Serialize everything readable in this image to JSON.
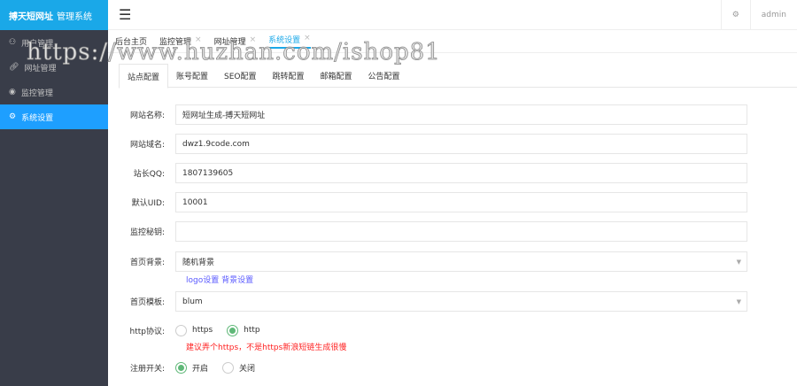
{
  "app": {
    "brand": "搏天短网址",
    "subtitle": "管理系统"
  },
  "sidebar": {
    "items": [
      {
        "label": "用户管理",
        "icon": "users-icon"
      },
      {
        "label": "网址管理",
        "icon": "link-icon"
      },
      {
        "label": "监控管理",
        "icon": "eye-icon"
      },
      {
        "label": "系统设置",
        "icon": "gear-icon"
      }
    ]
  },
  "header": {
    "user": "admin"
  },
  "tabs": [
    {
      "label": "后台主页"
    },
    {
      "label": "监控管理"
    },
    {
      "label": "网址管理"
    },
    {
      "label": "系统设置"
    }
  ],
  "close": "×",
  "subtabs": [
    "站点配置",
    "账号配置",
    "SEO配置",
    "跳转配置",
    "邮箱配置",
    "公告配置"
  ],
  "form": {
    "site_name": {
      "label": "网站名称:",
      "value": "短网址生成-搏天短网址"
    },
    "domain": {
      "label": "网站域名:",
      "value": "dwz1.9code.com"
    },
    "qq": {
      "label": "站长QQ:",
      "value": "1807139605"
    },
    "uid": {
      "label": "默认UID:",
      "value": "10001"
    },
    "secret": {
      "label": "监控秘钥:",
      "value": ""
    },
    "bg": {
      "label": "首页背景:",
      "value": "随机背景"
    },
    "bg_links": "logo设置 背景设置",
    "tpl": {
      "label": "首页模板:",
      "value": "blum"
    },
    "proto": {
      "label": "http协议:",
      "options": [
        "https",
        "http"
      ],
      "selected": "http",
      "warning": "建议弄个https，不是https新浪短链生成很慢"
    },
    "reg": {
      "label": "注册开关:",
      "options": [
        "开启",
        "关闭"
      ],
      "selected": "开启"
    }
  },
  "watermark": "https://www.huzhan.com/ishop81"
}
